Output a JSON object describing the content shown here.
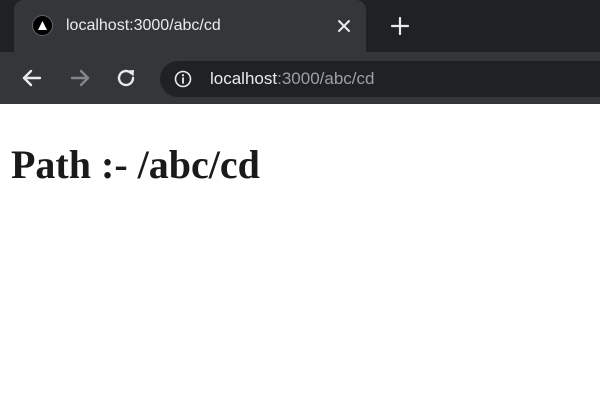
{
  "browser": {
    "tab": {
      "title": "localhost:3000/abc/cd",
      "favicon": "triangle-logo-icon",
      "close_icon": "close-icon"
    },
    "new_tab_icon": "plus-icon",
    "toolbar": {
      "back_icon": "arrow-left-icon",
      "forward_icon": "arrow-right-icon",
      "reload_icon": "reload-icon",
      "info_icon": "info-icon"
    },
    "address_bar": {
      "host": "localhost",
      "rest": ":3000/abc/cd"
    },
    "colors": {
      "tabstrip_bg": "#202124",
      "toolbar_bg": "#35363a",
      "omnibox_bg": "#202124",
      "text_primary": "#e8eaed",
      "text_secondary": "#9aa0a6"
    }
  },
  "page": {
    "heading": "Path :- /abc/cd"
  }
}
